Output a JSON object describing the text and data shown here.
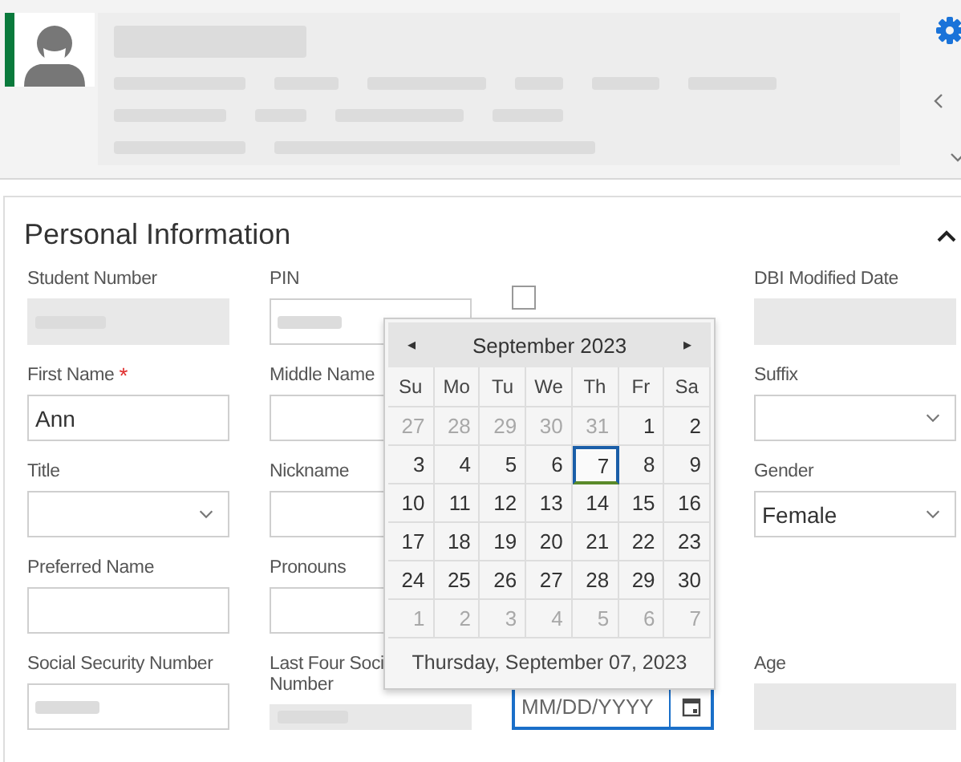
{
  "header": {
    "redacted": true
  },
  "section": {
    "title": "Personal Information",
    "expanded": true
  },
  "fields": [
    {
      "kind": "text",
      "label": "Student Number",
      "disabled": true,
      "redacted": true
    },
    {
      "kind": "text",
      "label": "PIN",
      "disabled": false,
      "redacted": true
    },
    {
      "kind": "checkbox",
      "checked": false
    },
    {
      "kind": "text",
      "label": "DBI Modified Date",
      "disabled": true
    },
    {
      "kind": "text",
      "label": "First Name",
      "required": true,
      "required_mark": "*",
      "value": "Ann",
      "disabled": false
    },
    {
      "kind": "text",
      "label": "Middle Name",
      "disabled": false
    },
    {
      "kind": "empty"
    },
    {
      "kind": "select",
      "label": "Suffix"
    },
    {
      "kind": "select",
      "label": "Title"
    },
    {
      "kind": "text",
      "label": "Nickname",
      "disabled": false
    },
    {
      "kind": "empty"
    },
    {
      "kind": "select",
      "label": "Gender",
      "value": "Female"
    },
    {
      "kind": "text",
      "label": "Preferred Name",
      "disabled": false
    },
    {
      "kind": "text",
      "label": "Pronouns",
      "disabled": false
    },
    {
      "kind": "empty"
    },
    {
      "kind": "empty"
    },
    {
      "kind": "text",
      "label": "Social Security Number",
      "disabled": false,
      "redacted": true
    },
    {
      "kind": "text",
      "label": "Last Four Soci",
      "label_line_2": "Number",
      "disabled": true,
      "redacted": true
    },
    {
      "kind": "date",
      "placeholder": "MM/DD/YYYY",
      "focused": true
    },
    {
      "kind": "text",
      "label": "Age",
      "disabled": true
    }
  ],
  "calendar": {
    "prev": "◂",
    "next": "▸",
    "month": "September 2023",
    "weekdays": [
      "Su",
      "Mo",
      "Tu",
      "We",
      "Th",
      "Fr",
      "Sa"
    ],
    "weeks": [
      [
        {
          "day": "27",
          "other": true,
          "selected": false
        },
        {
          "day": "28",
          "other": true,
          "selected": false
        },
        {
          "day": "29",
          "other": true,
          "selected": false
        },
        {
          "day": "30",
          "other": true,
          "selected": false
        },
        {
          "day": "31",
          "other": true,
          "selected": false
        },
        {
          "day": "1",
          "other": false,
          "selected": false
        },
        {
          "day": "2",
          "other": false,
          "selected": false
        }
      ],
      [
        {
          "day": "3",
          "other": false,
          "selected": false
        },
        {
          "day": "4",
          "other": false,
          "selected": false
        },
        {
          "day": "5",
          "other": false,
          "selected": false
        },
        {
          "day": "6",
          "other": false,
          "selected": false
        },
        {
          "day": "7",
          "other": false,
          "selected": true
        },
        {
          "day": "8",
          "other": false,
          "selected": false
        },
        {
          "day": "9",
          "other": false,
          "selected": false
        }
      ],
      [
        {
          "day": "10",
          "other": false,
          "selected": false
        },
        {
          "day": "11",
          "other": false,
          "selected": false
        },
        {
          "day": "12",
          "other": false,
          "selected": false
        },
        {
          "day": "13",
          "other": false,
          "selected": false
        },
        {
          "day": "14",
          "other": false,
          "selected": false
        },
        {
          "day": "15",
          "other": false,
          "selected": false
        },
        {
          "day": "16",
          "other": false,
          "selected": false
        }
      ],
      [
        {
          "day": "17",
          "other": false,
          "selected": false
        },
        {
          "day": "18",
          "other": false,
          "selected": false
        },
        {
          "day": "19",
          "other": false,
          "selected": false
        },
        {
          "day": "20",
          "other": false,
          "selected": false
        },
        {
          "day": "21",
          "other": false,
          "selected": false
        },
        {
          "day": "22",
          "other": false,
          "selected": false
        },
        {
          "day": "23",
          "other": false,
          "selected": false
        }
      ],
      [
        {
          "day": "24",
          "other": false,
          "selected": false
        },
        {
          "day": "25",
          "other": false,
          "selected": false
        },
        {
          "day": "26",
          "other": false,
          "selected": false
        },
        {
          "day": "27",
          "other": false,
          "selected": false
        },
        {
          "day": "28",
          "other": false,
          "selected": false
        },
        {
          "day": "29",
          "other": false,
          "selected": false
        },
        {
          "day": "30",
          "other": false,
          "selected": false
        }
      ],
      [
        {
          "day": "1",
          "other": true,
          "selected": false
        },
        {
          "day": "2",
          "other": true,
          "selected": false
        },
        {
          "day": "3",
          "other": true,
          "selected": false
        },
        {
          "day": "4",
          "other": true,
          "selected": false
        },
        {
          "day": "5",
          "other": true,
          "selected": false
        },
        {
          "day": "6",
          "other": true,
          "selected": false
        },
        {
          "day": "7",
          "other": true,
          "selected": false
        }
      ]
    ],
    "footer": "Thursday, September 07, 2023"
  }
}
